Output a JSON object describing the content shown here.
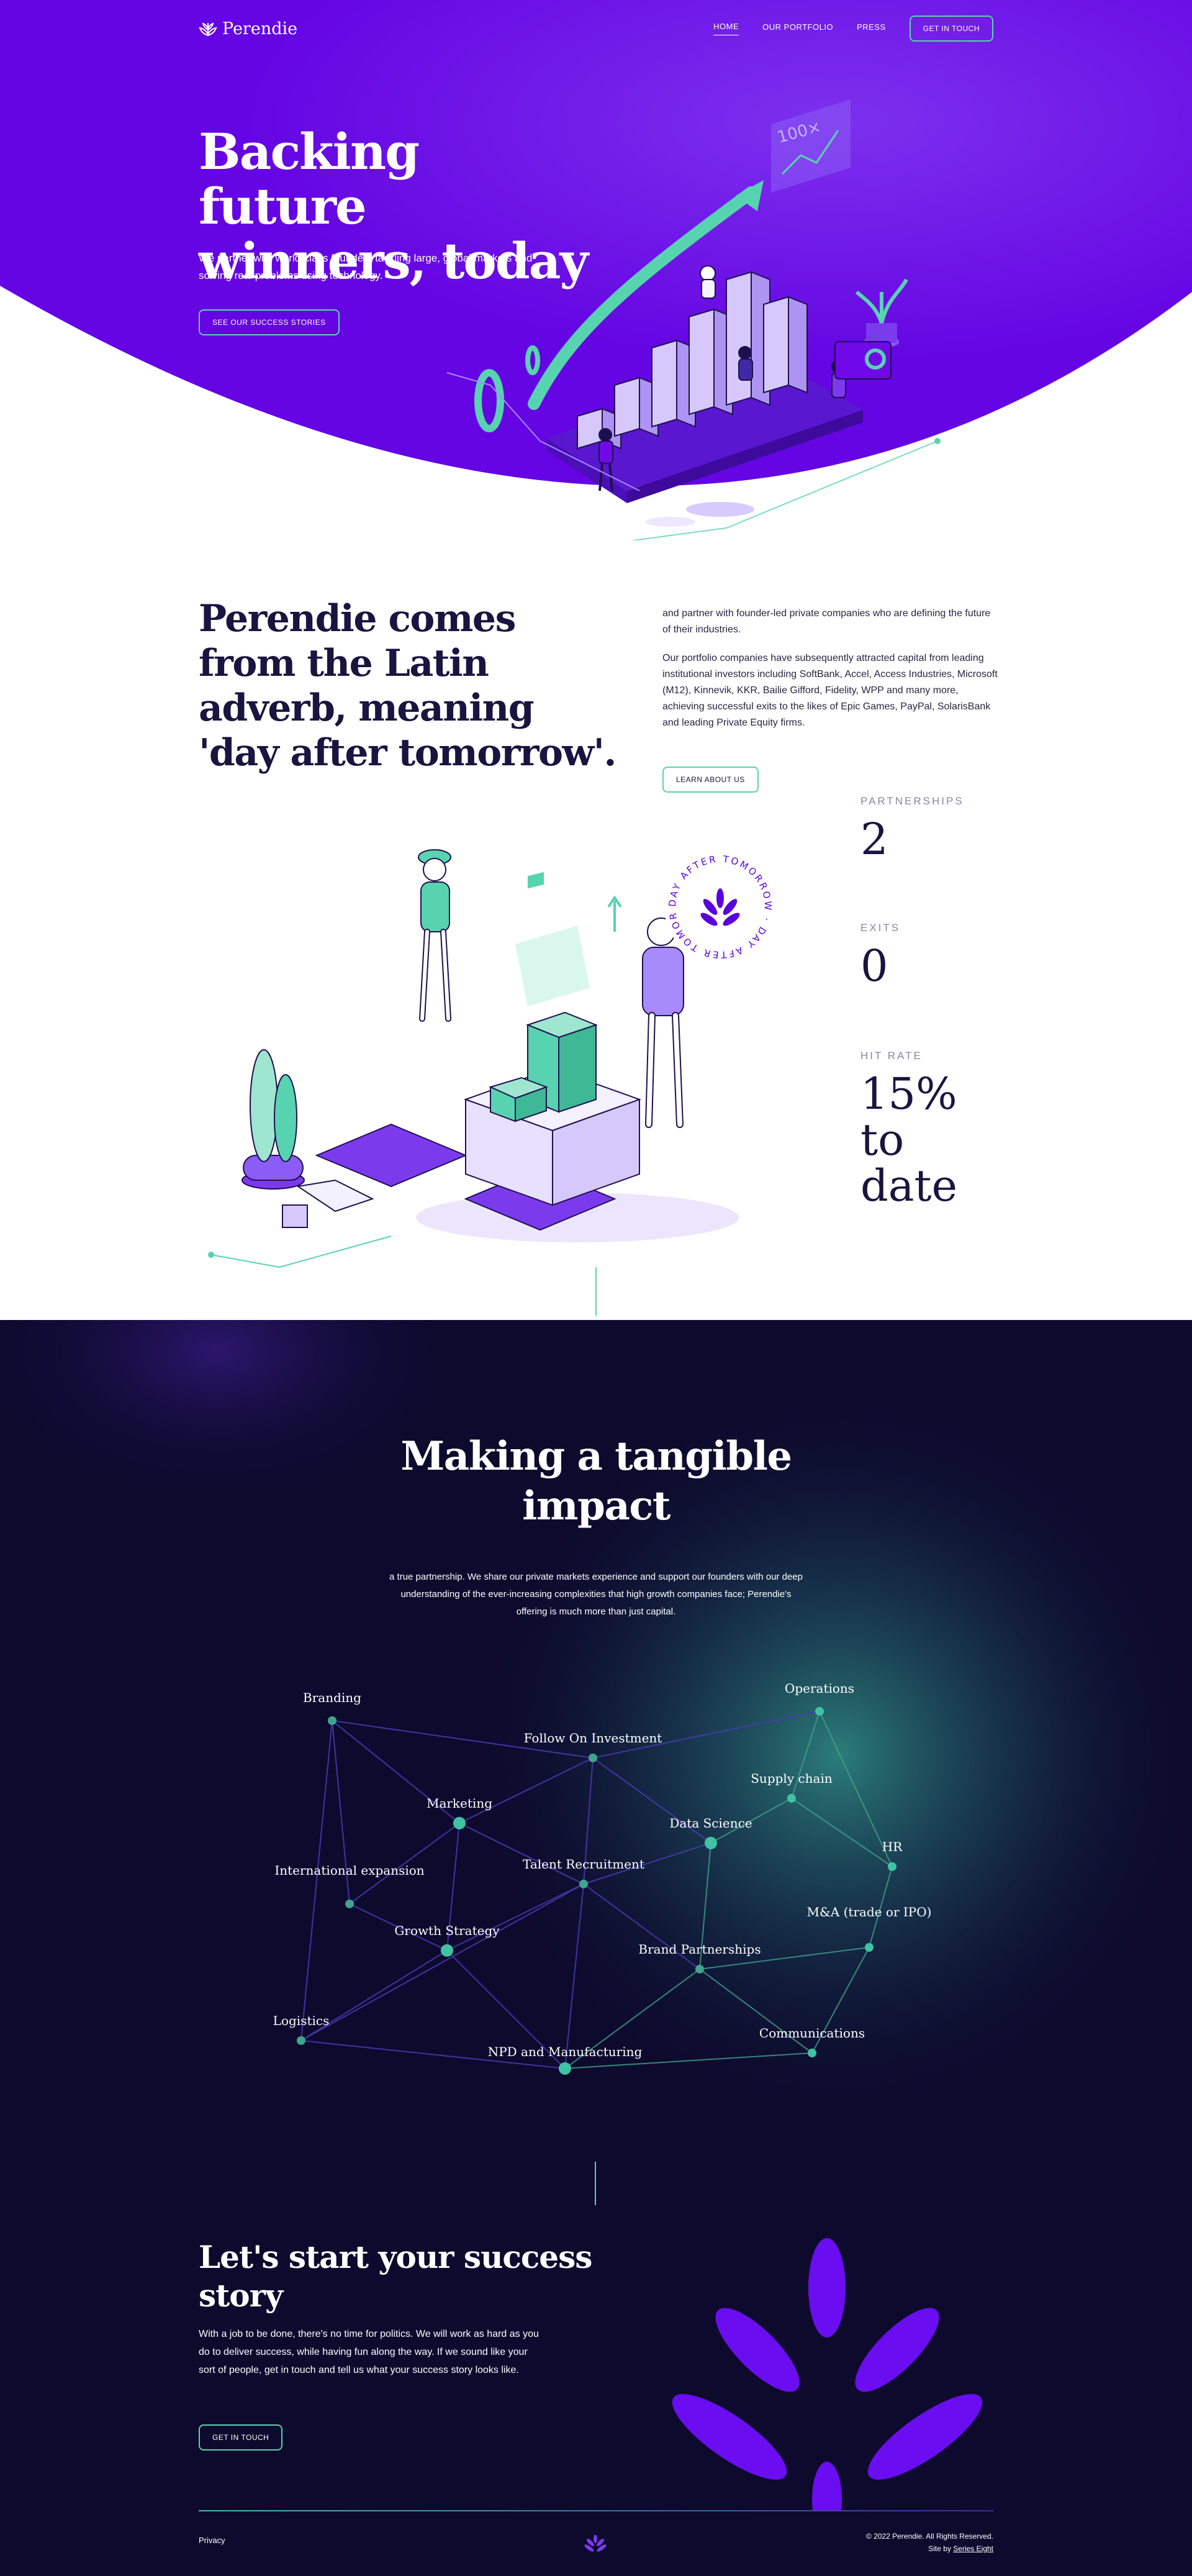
{
  "nav": {
    "brand": "Perendie",
    "links": [
      {
        "label": "HOME",
        "active": true
      },
      {
        "label": "OUR PORTFOLIO",
        "active": false
      },
      {
        "label": "PRESS",
        "active": false
      }
    ],
    "cta": "GET IN TOUCH"
  },
  "hero": {
    "title_line1": "Backing future",
    "title_line2": "winners, today",
    "subtitle": "We partner with world-class founders tackling large, global markets and solving real problems using technology.",
    "button": "SEE OUR SUCCESS STORIES",
    "illustration_label": "100×"
  },
  "about": {
    "title": "Perendie comes from the Latin adverb, meaning 'day after tomorrow'.",
    "paragraph1": "and partner with founder-led private companies who are defining the future of their industries.",
    "paragraph2": "Our portfolio companies have subsequently attracted capital from leading institutional investors including SoftBank, Accel, Access Industries, Microsoft (M12), Kinnevik, KKR, Bailie Gifford, Fidelity, WPP and many more, achieving successful exits to the likes of Epic Games, PayPal, SolarisBank and leading Private Equity firms.",
    "button": "LEARN ABOUT US",
    "badge_text": "DAY AFTER TOMORROW · DAY AFTER TOMORROW ·"
  },
  "stats": [
    {
      "label": "PARTNERSHIPS",
      "value": "2"
    },
    {
      "label": "EXITS",
      "value": "0"
    },
    {
      "label": "HIT RATE",
      "value": "15% to date"
    }
  ],
  "impact": {
    "title": "Making a tangible impact",
    "subtitle": "a true partnership. We share our private markets experience and support our founders with our deep understanding of the ever-increasing complexities that high growth companies face; Perendie's offering is much more than just capital.",
    "nodes": [
      {
        "label": "Branding"
      },
      {
        "label": "Follow On Investment"
      },
      {
        "label": "Operations"
      },
      {
        "label": "Supply chain"
      },
      {
        "label": "Marketing"
      },
      {
        "label": "Data Science"
      },
      {
        "label": "HR"
      },
      {
        "label": "International expansion"
      },
      {
        "label": "Talent Recruitment"
      },
      {
        "label": "M&A (trade or IPO)"
      },
      {
        "label": "Growth Strategy"
      },
      {
        "label": "Brand Partnerships"
      },
      {
        "label": "Logistics"
      },
      {
        "label": "Communications"
      },
      {
        "label": "NPD and Manufacturing"
      }
    ]
  },
  "cta": {
    "title": "Let's start your success story",
    "body": "With a job to be done, there's no time for politics. We will work as hard as you do to deliver success, while having fun along the way. If we sound like your sort of people, get in touch and tell us what your success story looks like.",
    "button": "GET IN TOUCH"
  },
  "footer": {
    "privacy": "Privacy",
    "copyright": "© 2022 Perendie. All Rights Reserved.",
    "credit_prefix": "Site by",
    "credit_link": "Series Eight"
  },
  "colors": {
    "hero_purple": "#6f09e8",
    "teal": "#58d3b0",
    "dark_navy": "#0d0a2e",
    "leaf_purple": "#6a0df0"
  }
}
